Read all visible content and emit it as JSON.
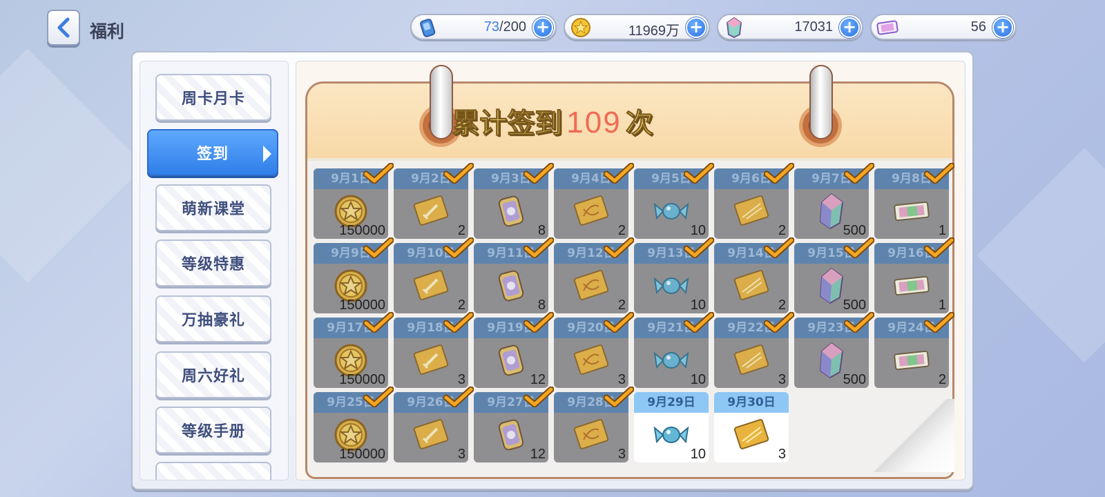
{
  "header": {
    "title": "福利",
    "back_icon": "chevron-left-icon"
  },
  "resources": [
    {
      "id": "stamina",
      "icon": "stamina-can-icon",
      "value_current": "73",
      "value_rest": "/200"
    },
    {
      "id": "coins",
      "icon": "gold-coin-icon",
      "value_current": "",
      "value_rest": "11969万"
    },
    {
      "id": "crystals",
      "icon": "crystal-gem-icon",
      "value_current": "",
      "value_rest": "17031"
    },
    {
      "id": "tickets",
      "icon": "ticket-icon",
      "value_current": "",
      "value_rest": "56"
    }
  ],
  "sidebar": {
    "items": [
      {
        "label": "周卡月卡",
        "active": false
      },
      {
        "label": "签到",
        "active": true
      },
      {
        "label": "萌新课堂",
        "active": false
      },
      {
        "label": "等级特惠",
        "active": false
      },
      {
        "label": "万抽豪礼",
        "active": false
      },
      {
        "label": "周六好礼",
        "active": false
      },
      {
        "label": "等级手册",
        "active": false
      }
    ]
  },
  "calendar": {
    "title_prefix": "累计签到",
    "count": "109",
    "title_suffix": "次",
    "days": [
      {
        "date": "9月1日",
        "item": "gold-coin",
        "qty": "150000",
        "claimed": true
      },
      {
        "date": "9月2日",
        "item": "gold-card-sword",
        "qty": "2",
        "claimed": true
      },
      {
        "date": "9月3日",
        "item": "purple-can",
        "qty": "8",
        "claimed": true
      },
      {
        "date": "9月4日",
        "item": "gold-card-dna",
        "qty": "2",
        "claimed": true
      },
      {
        "date": "9月5日",
        "item": "blue-candy",
        "qty": "10",
        "claimed": true
      },
      {
        "date": "9月6日",
        "item": "gold-card-shield",
        "qty": "2",
        "claimed": true
      },
      {
        "date": "9月7日",
        "item": "crystal-gem",
        "qty": "500",
        "claimed": true
      },
      {
        "date": "9月8日",
        "item": "rainbow-ticket",
        "qty": "1",
        "claimed": true
      },
      {
        "date": "9月9日",
        "item": "gold-coin",
        "qty": "150000",
        "claimed": true
      },
      {
        "date": "9月10日",
        "item": "gold-card-sword",
        "qty": "2",
        "claimed": true
      },
      {
        "date": "9月11日",
        "item": "purple-can",
        "qty": "8",
        "claimed": true
      },
      {
        "date": "9月12日",
        "item": "gold-card-dna",
        "qty": "2",
        "claimed": true
      },
      {
        "date": "9月13日",
        "item": "blue-candy",
        "qty": "10",
        "claimed": true
      },
      {
        "date": "9月14日",
        "item": "gold-card-shield",
        "qty": "2",
        "claimed": true
      },
      {
        "date": "9月15日",
        "item": "crystal-gem",
        "qty": "500",
        "claimed": true
      },
      {
        "date": "9月16日",
        "item": "rainbow-ticket",
        "qty": "1",
        "claimed": true
      },
      {
        "date": "9月17日",
        "item": "gold-coin",
        "qty": "150000",
        "claimed": true
      },
      {
        "date": "9月18日",
        "item": "gold-card-sword",
        "qty": "3",
        "claimed": true
      },
      {
        "date": "9月19日",
        "item": "purple-can",
        "qty": "12",
        "claimed": true
      },
      {
        "date": "9月20日",
        "item": "gold-card-dna",
        "qty": "3",
        "claimed": true
      },
      {
        "date": "9月21日",
        "item": "blue-candy",
        "qty": "10",
        "claimed": true
      },
      {
        "date": "9月22日",
        "item": "gold-card-shield",
        "qty": "3",
        "claimed": true
      },
      {
        "date": "9月23日",
        "item": "crystal-gem",
        "qty": "500",
        "claimed": true
      },
      {
        "date": "9月24日",
        "item": "rainbow-ticket",
        "qty": "2",
        "claimed": true
      },
      {
        "date": "9月25日",
        "item": "gold-coin",
        "qty": "150000",
        "claimed": true
      },
      {
        "date": "9月26日",
        "item": "gold-card-sword",
        "qty": "3",
        "claimed": true
      },
      {
        "date": "9月27日",
        "item": "purple-can",
        "qty": "12",
        "claimed": true
      },
      {
        "date": "9月28日",
        "item": "gold-card-dna",
        "qty": "3",
        "claimed": true
      },
      {
        "date": "9月29日",
        "item": "blue-candy",
        "qty": "10",
        "claimed": false
      },
      {
        "date": "9月30日",
        "item": "gold-card-shield",
        "qty": "3",
        "claimed": false
      }
    ]
  },
  "colors": {
    "accent_blue": "#2f7fe8",
    "checkmark": "#f5a623",
    "count_red": "#f06a55",
    "title_gold": "#f7dc6d"
  }
}
